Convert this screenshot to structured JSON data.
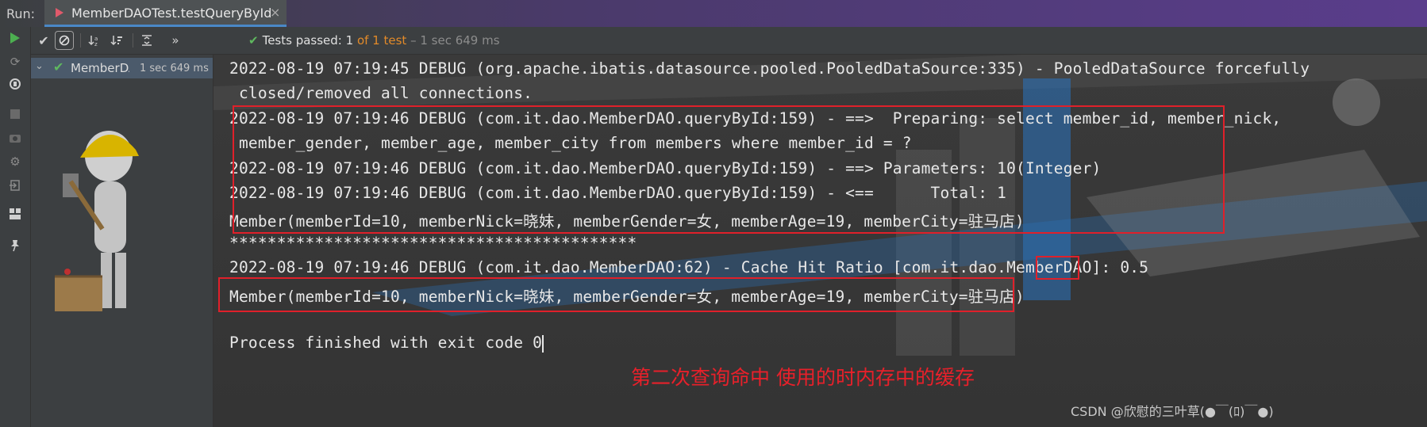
{
  "run_bar": {
    "label": "Run:",
    "tab_title": "MemberDAOTest.testQueryById",
    "tab_close": "×"
  },
  "toolbar": {
    "icons": [
      "check-icon",
      "cancel-filter-icon",
      "sort-alpha-icon",
      "sort-duration-icon",
      "expand-collapse-icon",
      "more-icon"
    ],
    "more": "»",
    "status_check": "✔",
    "status_passed": "Tests passed: 1",
    "status_of": "of 1 test",
    "status_time": "– 1 sec 649 ms"
  },
  "test_tree": {
    "item_name": "MemberDAOTest",
    "item_time": "1 sec 649 ms"
  },
  "console": {
    "lines": [
      "2022-08-19 07:19:45 DEBUG (org.apache.ibatis.datasource.pooled.PooledDataSource:335) - PooledDataSource forcefully",
      " closed/removed all connections.",
      "2022-08-19 07:19:46 DEBUG (com.it.dao.MemberDAO.queryById:159) - ==>  Preparing: select member_id, member_nick,",
      " member_gender, member_age, member_city from members where member_id = ?",
      "2022-08-19 07:19:46 DEBUG (com.it.dao.MemberDAO.queryById:159) - ==> Parameters: 10(Integer)",
      "2022-08-19 07:19:46 DEBUG (com.it.dao.MemberDAO.queryById:159) - <==      Total: 1",
      "Member(memberId=10, memberNick=晓妹, memberGender=女, memberAge=19, memberCity=驻马店)",
      "*******************************************",
      "2022-08-19 07:19:46 DEBUG (com.it.dao.MemberDAO:62) - Cache Hit Ratio [com.it.dao.MemberDAO]: 0.5",
      "Member(memberId=10, memberNick=晓妹, memberGender=女, memberAge=19, memberCity=驻马店)",
      "",
      "Process finished with exit code 0"
    ],
    "annotation": "第二次查询命中 使用的时内存中的缓存",
    "watermark": "CSDN @欣慰的三叶草(●￣(ﾛ)￣●)"
  },
  "colors": {
    "accent_tab": "#4a88c7",
    "pass_green": "#5fb85f",
    "test_count_orange": "#e28a29",
    "annotation_red": "#e0202a"
  }
}
